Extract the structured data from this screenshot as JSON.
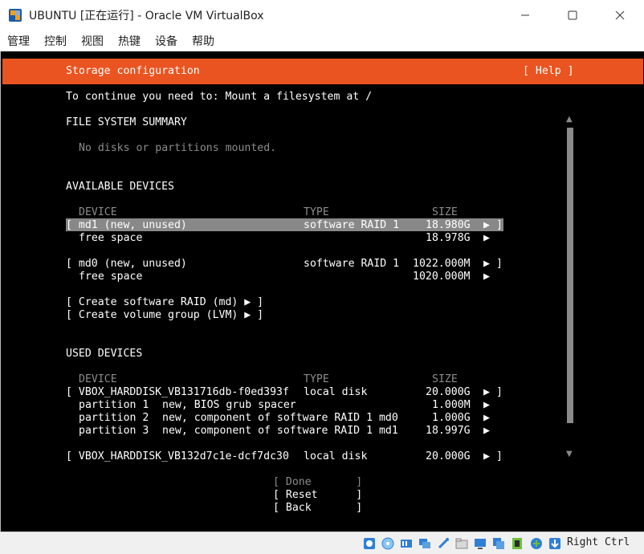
{
  "window": {
    "title": "UBUNTU [正在运行] - Oracle VM VirtualBox",
    "app_icon": "virtualbox-icon",
    "controls": [
      "minimize-icon",
      "maximize-icon",
      "close-icon"
    ]
  },
  "menu": [
    "管理",
    "控制",
    "视图",
    "热键",
    "设备",
    "帮助"
  ],
  "installer": {
    "header_title": "Storage configuration",
    "help_label": "[ Help ]",
    "instruction": "To continue you need to: Mount a filesystem at /",
    "fs_summary_heading": "FILE SYSTEM SUMMARY",
    "fs_summary_empty": "No disks or partitions mounted.",
    "available_heading": "AVAILABLE DEVICES",
    "col_device": "DEVICE",
    "col_type": "TYPE",
    "col_size": "SIZE",
    "available_devices": [
      {
        "name": "[ md1 (new, unused)",
        "type": "software RAID 1",
        "size": "18.980G",
        "arrow": "▶",
        "close": "]",
        "highlighted": true,
        "free_label": "free space",
        "free_size": "18.978G"
      },
      {
        "name": "[ md0 (new, unused)",
        "type": "software RAID 1",
        "size": "1022.000M",
        "arrow": "▶",
        "close": "]",
        "highlighted": false,
        "free_label": "free space",
        "free_size": "1020.000M"
      }
    ],
    "actions": [
      "[ Create software RAID (md) ▶ ]",
      "[ Create volume group (LVM) ▶ ]"
    ],
    "used_heading": "USED DEVICES",
    "used_disk1": {
      "name": "[ VBOX_HARDDISK_VB131716db-f0ed393f",
      "type": "local disk",
      "size": "20.000G",
      "arrow": "▶",
      "close": "]",
      "partitions": [
        {
          "name": "partition 1",
          "desc": "new, BIOS grub spacer",
          "size": "1.000M",
          "arrow": "▶"
        },
        {
          "name": "partition 2",
          "desc": "new, component of software RAID 1 md0",
          "size": "1.000G",
          "arrow": "▶"
        },
        {
          "name": "partition 3",
          "desc": "new, component of software RAID 1 md1",
          "size": "18.997G",
          "arrow": "▶"
        }
      ]
    },
    "used_disk2": {
      "name": "[ VBOX_HARDDISK_VB132d7c1e-dcf7dc30",
      "type": "local disk",
      "size": "20.000G",
      "arrow": "▶",
      "close": "]"
    },
    "buttons": [
      {
        "label": "[ Done       ]",
        "enabled": false
      },
      {
        "label": "[ Reset      ]",
        "enabled": true
      },
      {
        "label": "[ Back       ]",
        "enabled": true
      }
    ],
    "header_color": "#e95420"
  },
  "statusbar": {
    "hostkey_label": "Right Ctrl",
    "icons": [
      "hard-disk-icon",
      "optical-disk-icon",
      "audio-icon",
      "network-icon",
      "usb-icon",
      "shared-folder-icon",
      "display-icon",
      "video-capture-icon",
      "cpu-icon",
      "mouse-integration-icon",
      "keyboard-capture-icon"
    ]
  }
}
